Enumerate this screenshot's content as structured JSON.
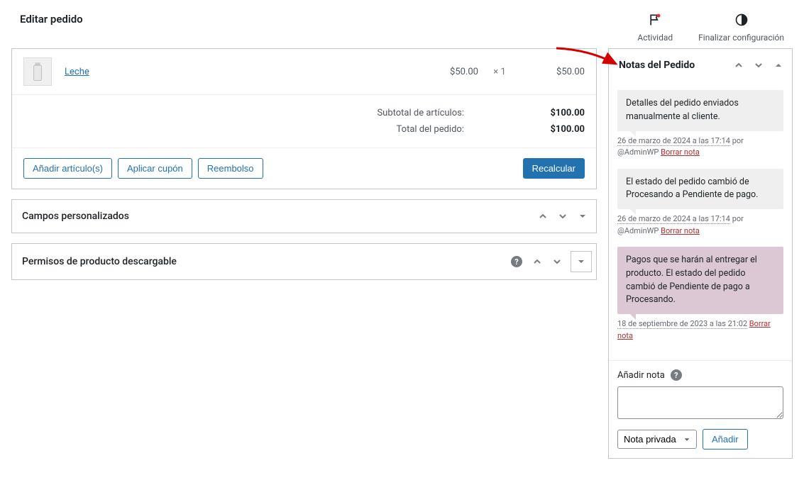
{
  "header": {
    "page_title": "Editar pedido",
    "activity_label": "Actividad",
    "finish_config_label": "Finalizar configuración"
  },
  "order": {
    "line_item": {
      "name": "Leche",
      "cost": "$50.00",
      "qty_symbol": "×",
      "qty": "1",
      "total": "$50.00"
    },
    "totals": {
      "subtotal_label": "Subtotal de artículos:",
      "subtotal_value": "$100.00",
      "order_total_label": "Total del pedido:",
      "order_total_value": "$100.00"
    },
    "actions": {
      "add_items": "Añadir artículo(s)",
      "apply_coupon": "Aplicar cupón",
      "refund": "Reembolso",
      "recalculate": "Recalcular"
    }
  },
  "panels": {
    "custom_fields": "Campos personalizados",
    "downloadable_perms": "Permisos de producto descargable"
  },
  "notes_panel": {
    "title": "Notas del Pedido",
    "notes": [
      {
        "color": "gray",
        "text": "Detalles del pedido enviados manualmente al cliente.",
        "timestamp": "26 de marzo de 2024 a las 17:14",
        "by": "por @AdminWP",
        "delete": "Borrar nota"
      },
      {
        "color": "gray",
        "text": "El estado del pedido cambió de Procesando a Pendiente de pago.",
        "timestamp": "26 de marzo de 2024 a las 17:14",
        "by": "por @AdminWP",
        "delete": "Borrar nota"
      },
      {
        "color": "purple",
        "text": "Pagos que se harán al entregar el producto. El estado del pedido cambió de Pendiente de pago a Procesando.",
        "timestamp": "18 de septiembre de 2023 a las 21:02",
        "by": "",
        "delete": "Borrar nota"
      }
    ],
    "add_note_label": "Añadir nota",
    "note_type_selected": "Nota privada",
    "add_button": "Añadir"
  }
}
